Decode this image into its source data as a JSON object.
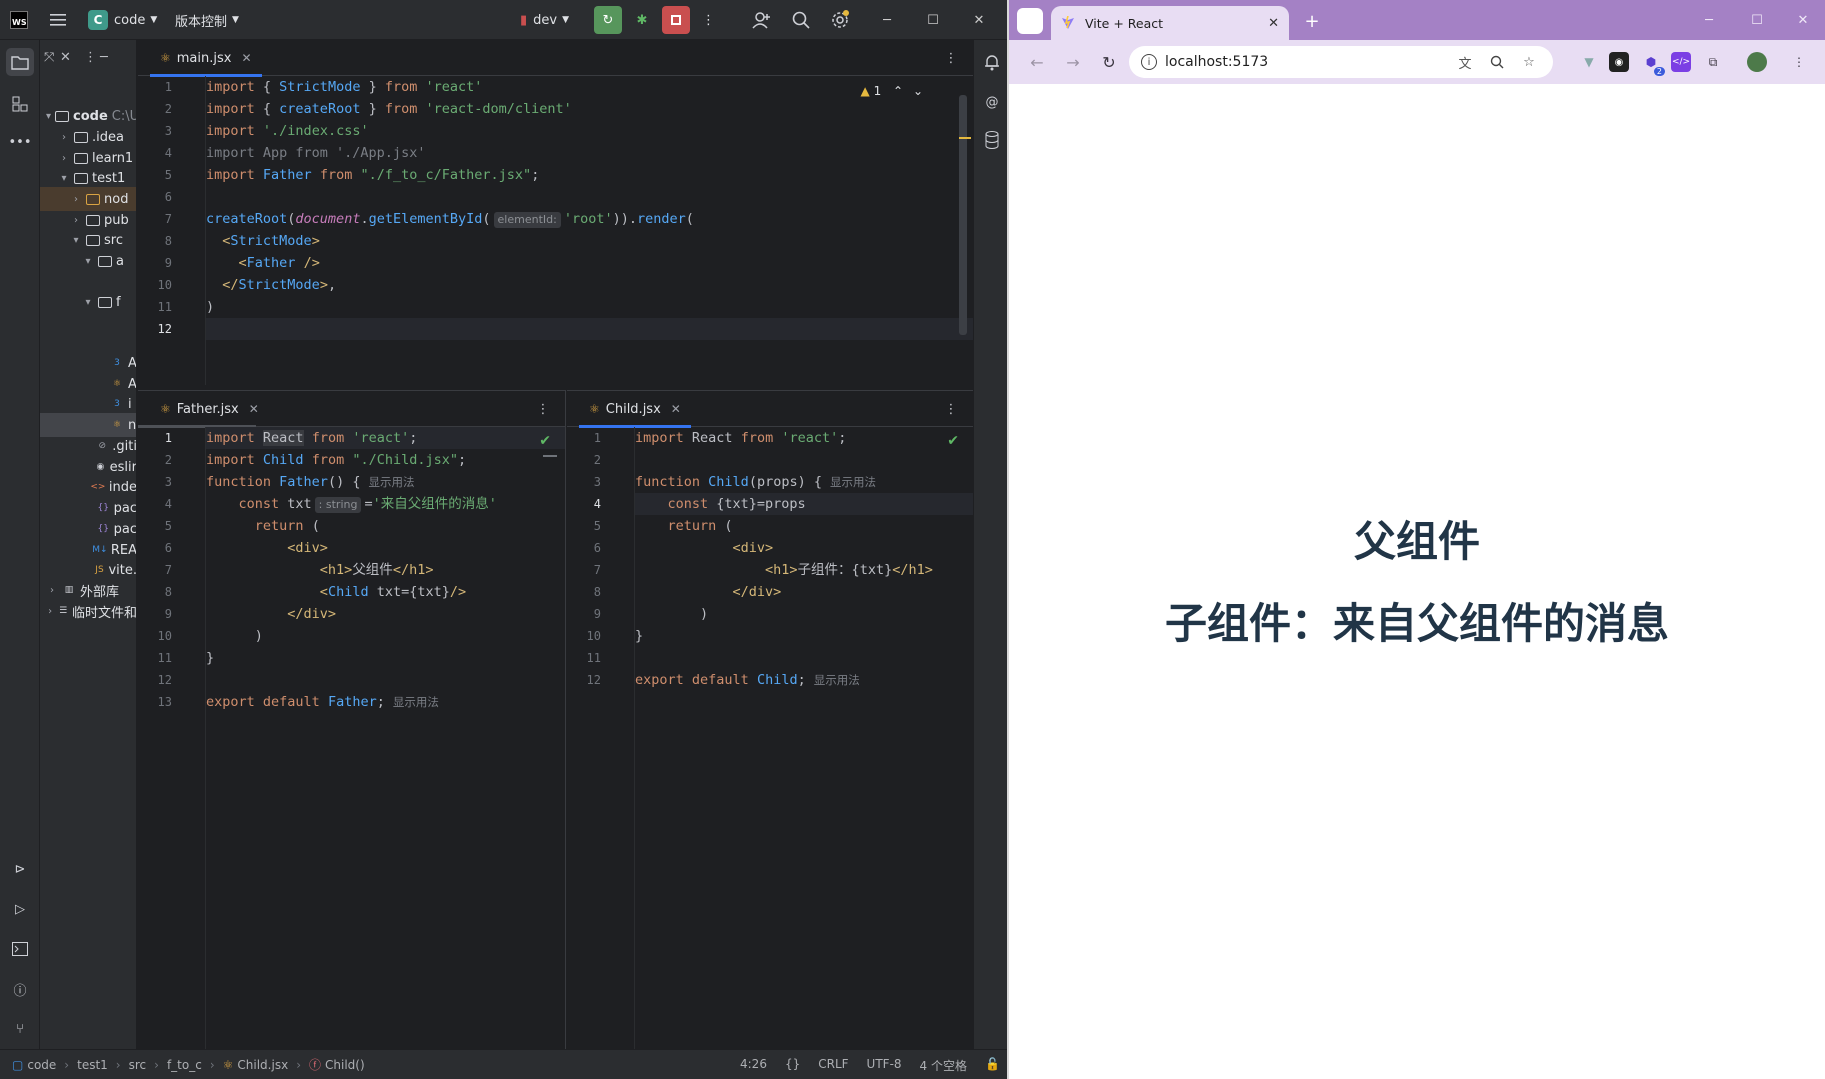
{
  "ide": {
    "logo": "WS",
    "project_badge": "C",
    "project_name": "code",
    "vcs_label": "版本控制",
    "run_config": "dev",
    "tree": [
      {
        "label": "code",
        "suffix": "C:\\U",
        "chevron": "▾",
        "icon": "folder"
      },
      {
        "label": ".idea",
        "chevron": "›",
        "icon": "folder"
      },
      {
        "label": "learn1",
        "chevron": "›",
        "icon": "folder"
      },
      {
        "label": "test1",
        "chevron": "▾",
        "icon": "folder"
      },
      {
        "label": "nod",
        "chevron": "›",
        "icon": "folder-orange"
      },
      {
        "label": "pub",
        "chevron": "›",
        "icon": "folder"
      },
      {
        "label": "src",
        "chevron": "▾",
        "icon": "folder"
      },
      {
        "label": "a",
        "chevron": "▾",
        "icon": "folder"
      },
      {
        "label": "",
        "chevron": "",
        "icon": ""
      },
      {
        "label": "f",
        "chevron": "▾",
        "icon": "folder"
      },
      {
        "label": "",
        "chevron": "",
        "icon": ""
      },
      {
        "label": "",
        "chevron": "",
        "icon": ""
      },
      {
        "label": "A",
        "chevron": "",
        "icon": "css"
      },
      {
        "label": "A",
        "chevron": "",
        "icon": "react"
      },
      {
        "label": "i",
        "chevron": "",
        "icon": "css"
      },
      {
        "label": "n",
        "chevron": "",
        "icon": "react"
      },
      {
        "label": ".giti",
        "chevron": "",
        "icon": "ignore"
      },
      {
        "label": "eslir",
        "chevron": "",
        "icon": "eslint"
      },
      {
        "label": "inde",
        "chevron": "",
        "icon": "html"
      },
      {
        "label": "pac",
        "chevron": "",
        "icon": "json"
      },
      {
        "label": "pac",
        "chevron": "",
        "icon": "json"
      },
      {
        "label": "REA",
        "chevron": "",
        "icon": "md"
      },
      {
        "label": "vite.",
        "chevron": "",
        "icon": "js"
      },
      {
        "label": "外部库",
        "chevron": "›",
        "icon": "lib"
      },
      {
        "label": "临时文件和",
        "chevron": "›",
        "icon": "scratch"
      }
    ],
    "main_editor": {
      "tab": "main.jsx",
      "warning_count": "1",
      "inlay_hint": "elementId:",
      "lines": [
        "1",
        "2",
        "3",
        "4",
        "5",
        "6",
        "7",
        "8",
        "9",
        "10",
        "11",
        "12"
      ]
    },
    "father_editor": {
      "tab": "Father.jsx",
      "type_hint": ": string",
      "usage_hint": "显示用法",
      "lines": [
        "1",
        "2",
        "3",
        "4",
        "5",
        "6",
        "7",
        "8",
        "9",
        "10",
        "11",
        "12",
        "13"
      ]
    },
    "child_editor": {
      "tab": "Child.jsx",
      "usage_hint": "显示用法",
      "lines": [
        "1",
        "2",
        "3",
        "4",
        "5",
        "6",
        "7",
        "8",
        "9",
        "10",
        "11",
        "12"
      ]
    },
    "status": {
      "breadcrumbs": [
        "code",
        "test1",
        "src",
        "f_to_c",
        "Child.jsx",
        "Child()"
      ],
      "position": "4:26",
      "braces": "{}",
      "line_ending": "CRLF",
      "encoding": "UTF-8",
      "indent": "4 个空格"
    }
  },
  "browser": {
    "tab_title": "Vite + React",
    "url": "localhost:5173",
    "ext_badge": "2",
    "page": {
      "h1_parent": "父组件",
      "h1_child": "子组件：来自父组件的消息"
    }
  },
  "colors": {
    "ide_bg": "#1e1f22",
    "ide_panel": "#2b2d30",
    "accent_blue": "#3574f0",
    "browser_frame": "#a481c5",
    "browser_toolbar": "#e8ddf3",
    "heading": "#213547"
  }
}
